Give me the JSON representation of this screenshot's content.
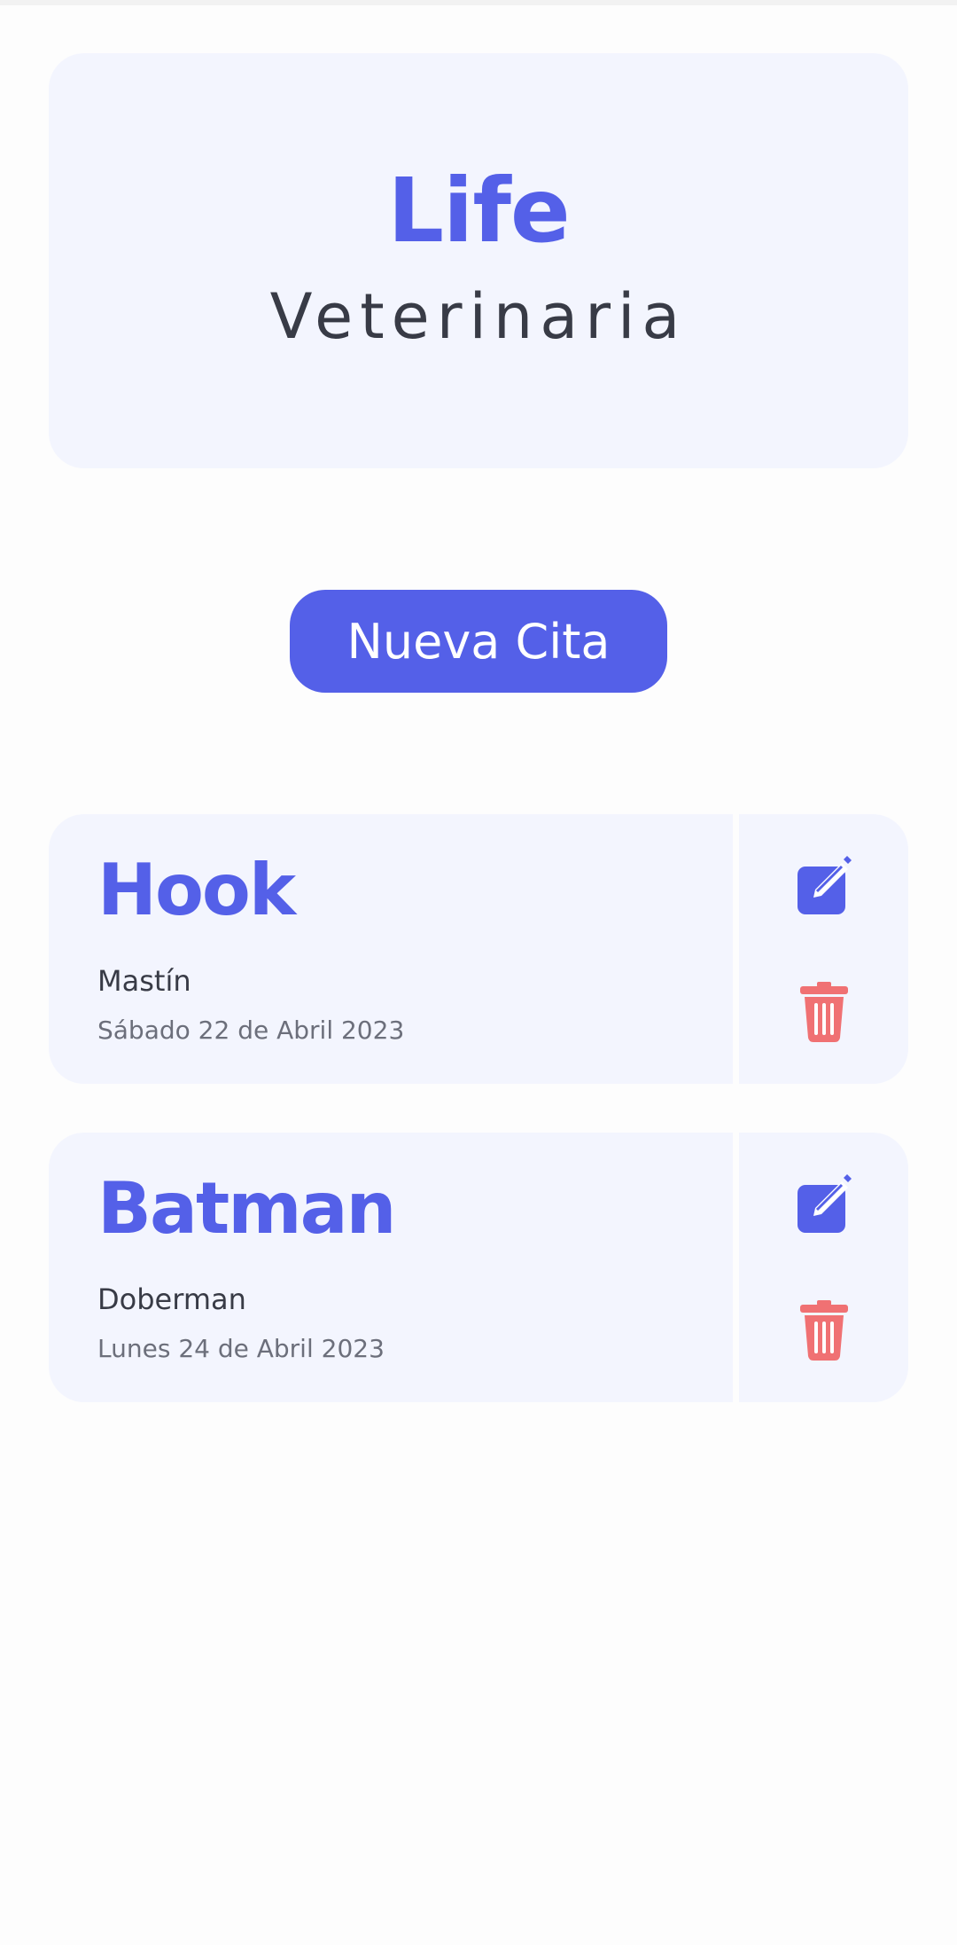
{
  "header": {
    "title": "Life",
    "subtitle": "Veterinaria"
  },
  "actions": {
    "new_appointment_label": "Nueva Cita"
  },
  "appointments": [
    {
      "pet_name": "Hook",
      "breed": "Mastín",
      "date": "Sábado 22 de Abril 2023"
    },
    {
      "pet_name": "Batman",
      "breed": "Doberman",
      "date": "Lunes 24 de Abril 2023"
    }
  ],
  "icons": {
    "edit": "edit-icon",
    "delete": "trash-icon"
  },
  "colors": {
    "accent": "#5460e8",
    "danger": "#f07173",
    "card_background": "#f3f5fe",
    "text_primary": "#383b46",
    "text_secondary": "#6c6f7b"
  }
}
